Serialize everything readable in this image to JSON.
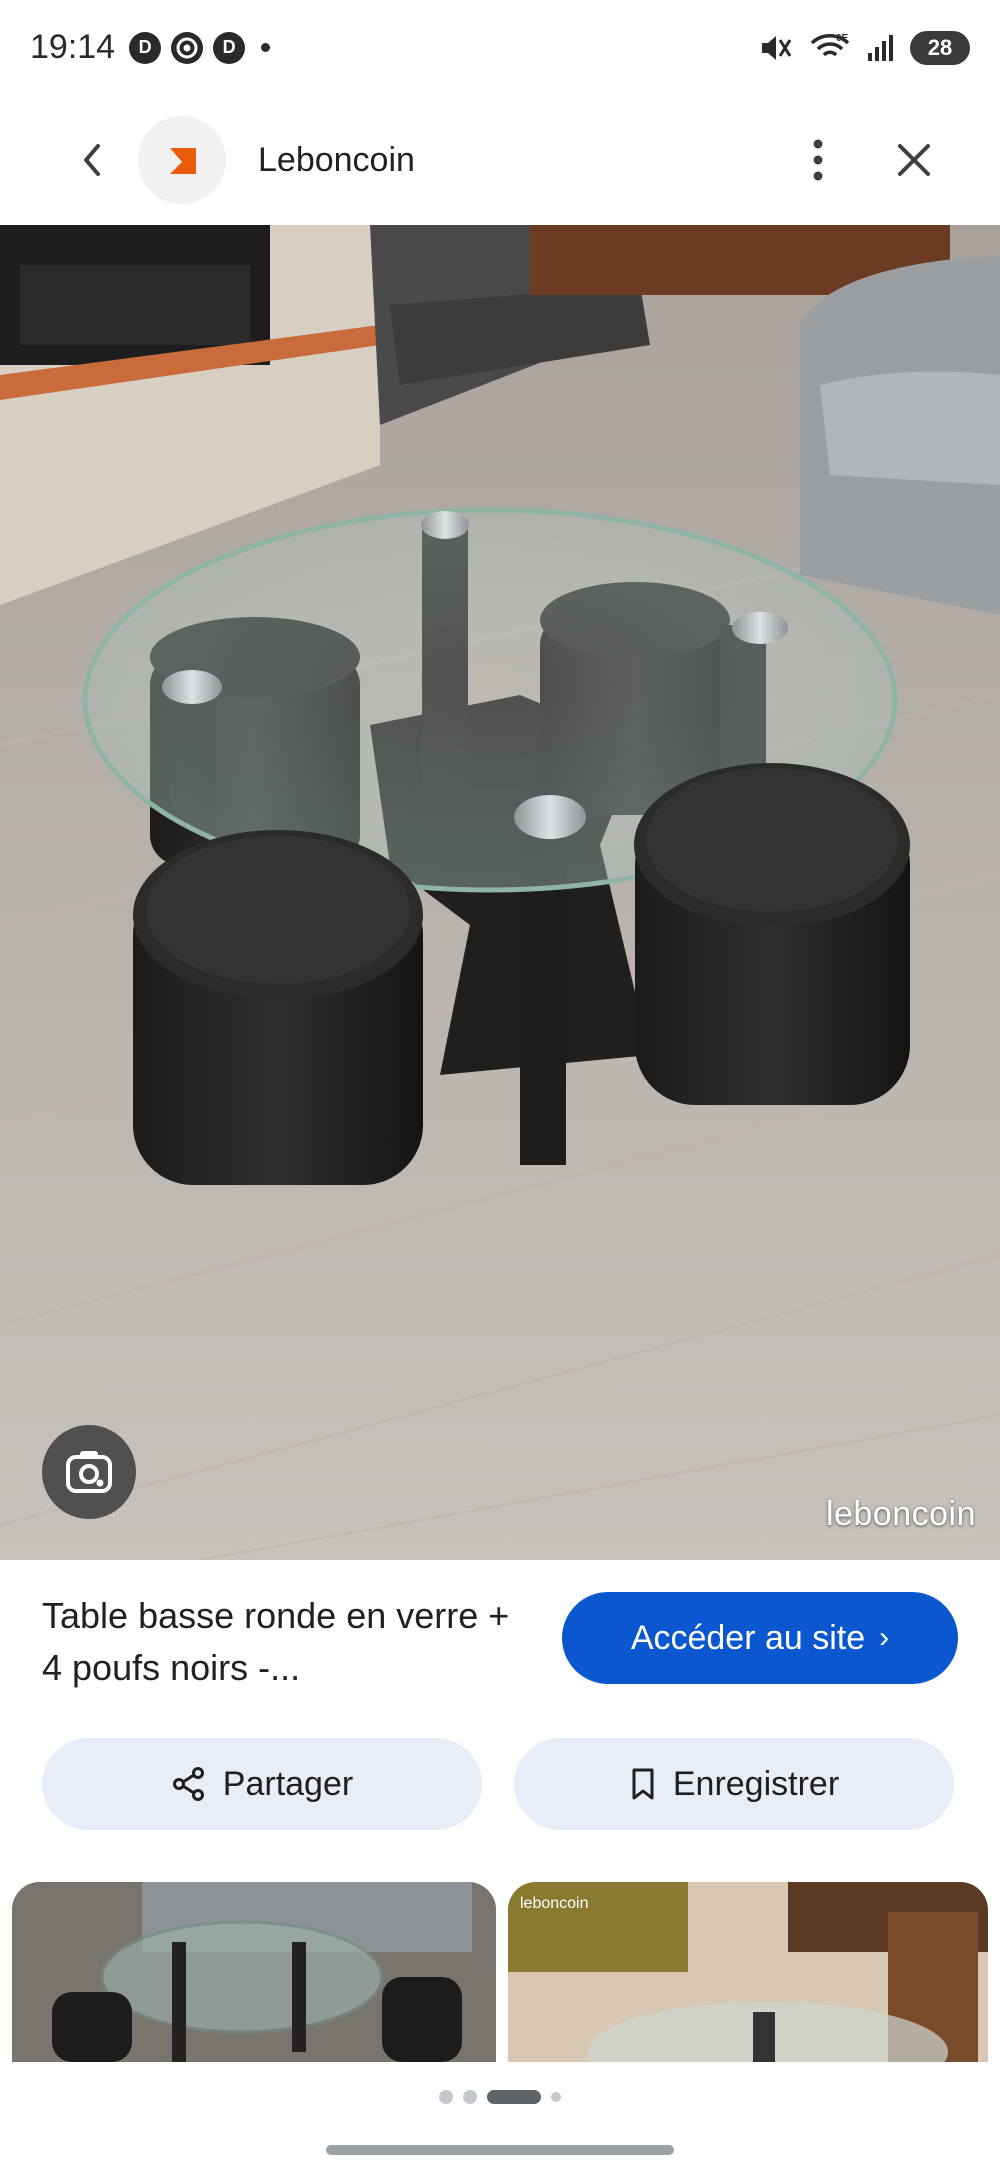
{
  "status_bar": {
    "time": "19:14",
    "app_icons": [
      "D",
      "chrome",
      "D"
    ],
    "battery": "28",
    "network_label": "6E"
  },
  "app_bar": {
    "title": "Leboncoin",
    "logo_colors": {
      "primary": "#ea5b0c",
      "secondary": "#333333"
    }
  },
  "image": {
    "watermark": "leboncoin"
  },
  "result": {
    "title": "Table basse ronde en verre + 4 poufs noirs -...",
    "visit_label": "Accéder au site",
    "accent": "#0b57d0"
  },
  "actions": {
    "share_label": "Partager",
    "save_label": "Enregistrer"
  },
  "related": {
    "thumb_watermark": "leboncoin"
  }
}
